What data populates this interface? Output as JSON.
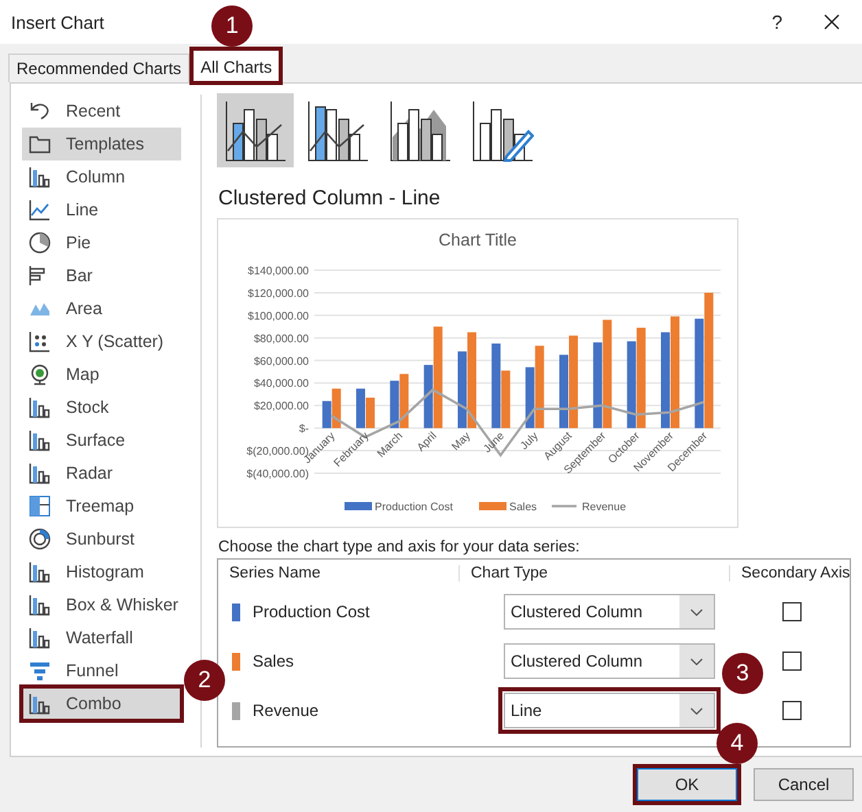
{
  "window": {
    "title": "Insert Chart",
    "help": "?"
  },
  "tabs": [
    {
      "label": "Recommended Charts",
      "selected": false
    },
    {
      "label": "All Charts",
      "selected": true,
      "callout": "1"
    }
  ],
  "sidebar": {
    "items": [
      {
        "label": "Recent",
        "selected": false
      },
      {
        "label": "Templates",
        "selected": true
      },
      {
        "label": "Column",
        "selected": false
      },
      {
        "label": "Line",
        "selected": false
      },
      {
        "label": "Pie",
        "selected": false
      },
      {
        "label": "Bar",
        "selected": false
      },
      {
        "label": "Area",
        "selected": false
      },
      {
        "label": "X Y (Scatter)",
        "selected": false
      },
      {
        "label": "Map",
        "selected": false
      },
      {
        "label": "Stock",
        "selected": false
      },
      {
        "label": "Surface",
        "selected": false
      },
      {
        "label": "Radar",
        "selected": false
      },
      {
        "label": "Treemap",
        "selected": false
      },
      {
        "label": "Sunburst",
        "selected": false
      },
      {
        "label": "Histogram",
        "selected": false
      },
      {
        "label": "Box & Whisker",
        "selected": false
      },
      {
        "label": "Waterfall",
        "selected": false
      },
      {
        "label": "Funnel",
        "selected": false
      },
      {
        "label": "Combo",
        "selected": true,
        "callout": "2"
      }
    ]
  },
  "chart_subtypes": [
    {
      "selected": true
    },
    {
      "selected": false
    },
    {
      "selected": false
    },
    {
      "selected": false
    }
  ],
  "preview": {
    "heading": "Clustered Column - Line",
    "chart_data": {
      "type": "bar",
      "title": "Chart Title",
      "categories": [
        "January",
        "February",
        "March",
        "April",
        "May",
        "June",
        "July",
        "August",
        "September",
        "October",
        "November",
        "December"
      ],
      "series": [
        {
          "name": "Production Cost",
          "color": "#4472c4",
          "values": [
            24000,
            35000,
            42000,
            56000,
            68000,
            75000,
            54000,
            65000,
            76000,
            77000,
            85000,
            97000
          ]
        },
        {
          "name": "Sales",
          "color": "#ed7d31",
          "values": [
            35000,
            27000,
            48000,
            90000,
            85000,
            51000,
            73000,
            82000,
            96000,
            89000,
            99000,
            120000
          ]
        },
        {
          "name": "Revenue",
          "color": "#a5a5a5",
          "type": "line",
          "values": [
            11000,
            -8000,
            6000,
            34000,
            17000,
            -24000,
            17000,
            17000,
            20000,
            12000,
            14000,
            23000
          ]
        }
      ],
      "ylim": [
        -40000,
        140000
      ],
      "grid": true,
      "legend": true,
      "yticks": [
        {
          "value": 140000,
          "label": "$140,000.00"
        },
        {
          "value": 120000,
          "label": "$120,000.00"
        },
        {
          "value": 100000,
          "label": "$100,000.00"
        },
        {
          "value": 80000,
          "label": "$80,000.00"
        },
        {
          "value": 60000,
          "label": "$60,000.00"
        },
        {
          "value": 40000,
          "label": "$40,000.00"
        },
        {
          "value": 20000,
          "label": "$20,000.00"
        },
        {
          "value": 0,
          "label": "$-"
        },
        {
          "value": -20000,
          "label": "$(20,000.00)"
        },
        {
          "value": -40000,
          "label": "$(40,000.00)"
        }
      ]
    }
  },
  "series_table": {
    "prompt": "Choose the chart type and axis for your data series:",
    "columns": [
      "Series Name",
      "Chart Type",
      "Secondary Axis"
    ],
    "rows": [
      {
        "name": "Production Cost",
        "color": "#4472c4",
        "chart_type": "Clustered Column",
        "secondary_axis": false
      },
      {
        "name": "Sales",
        "color": "#ed7d31",
        "chart_type": "Clustered Column",
        "secondary_axis": false
      },
      {
        "name": "Revenue",
        "color": "#a5a5a5",
        "chart_type": "Line",
        "secondary_axis": false,
        "callout": "3"
      }
    ]
  },
  "buttons": [
    {
      "label": "OK",
      "callout": "4"
    },
    {
      "label": "Cancel"
    }
  ]
}
